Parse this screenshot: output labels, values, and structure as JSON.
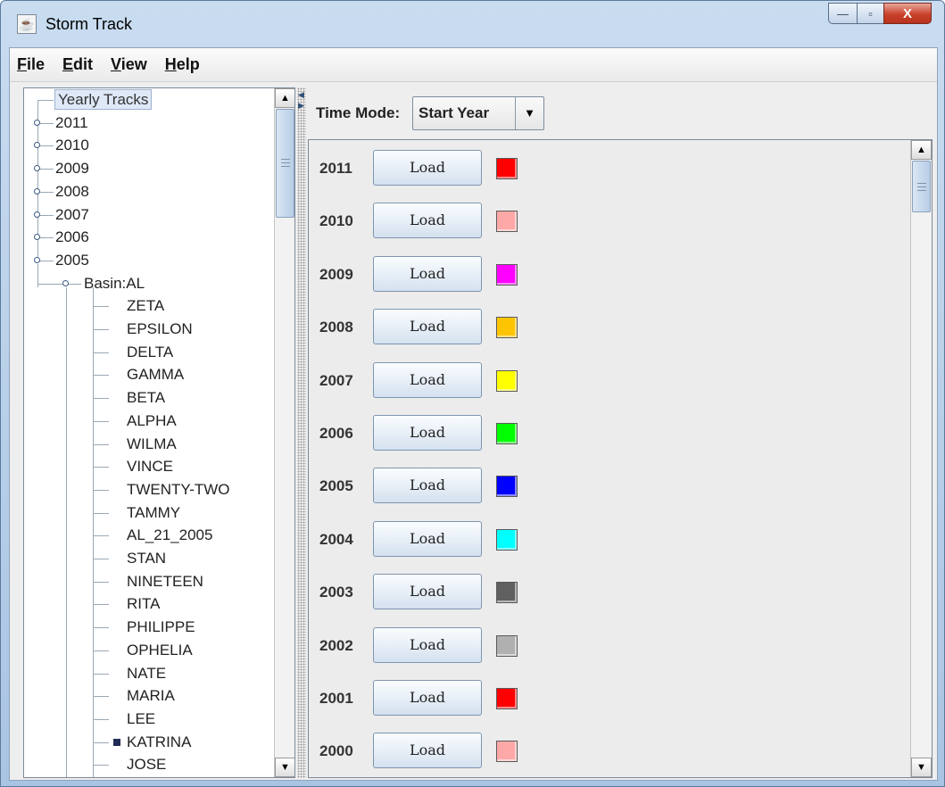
{
  "window": {
    "title": "Storm Track",
    "controls": {
      "minimize": "—",
      "maximize": "▫",
      "close": "X"
    }
  },
  "menu": [
    "File",
    "Edit",
    "View",
    "Help"
  ],
  "tree": {
    "root": "Yearly Tracks",
    "years": [
      "2011",
      "2010",
      "2009",
      "2008",
      "2007",
      "2006",
      "2005"
    ],
    "basin": "Basin:AL",
    "storms": [
      "ZETA",
      "EPSILON",
      "DELTA",
      "GAMMA",
      "BETA",
      "ALPHA",
      "WILMA",
      "VINCE",
      "TWENTY-TWO",
      "TAMMY",
      "AL_21_2005",
      "STAN",
      "NINETEEN",
      "RITA",
      "PHILIPPE",
      "OPHELIA",
      "NATE",
      "MARIA",
      "LEE",
      "KATRINA",
      "JOSE"
    ],
    "selected_storm": "KATRINA"
  },
  "time_mode": {
    "label": "Time Mode:",
    "value": "Start Year"
  },
  "load_label": "Load",
  "years_panel": [
    {
      "year": "2011",
      "color": "#ff0000"
    },
    {
      "year": "2010",
      "color": "#ffa8a8"
    },
    {
      "year": "2009",
      "color": "#ff00ff"
    },
    {
      "year": "2008",
      "color": "#ffc400"
    },
    {
      "year": "2007",
      "color": "#ffff00"
    },
    {
      "year": "2006",
      "color": "#00ff00"
    },
    {
      "year": "2005",
      "color": "#0000ff"
    },
    {
      "year": "2004",
      "color": "#00ffff"
    },
    {
      "year": "2003",
      "color": "#606060"
    },
    {
      "year": "2002",
      "color": "#b0b0b0"
    },
    {
      "year": "2001",
      "color": "#ff0000"
    },
    {
      "year": "2000",
      "color": "#ffa8a8"
    }
  ]
}
